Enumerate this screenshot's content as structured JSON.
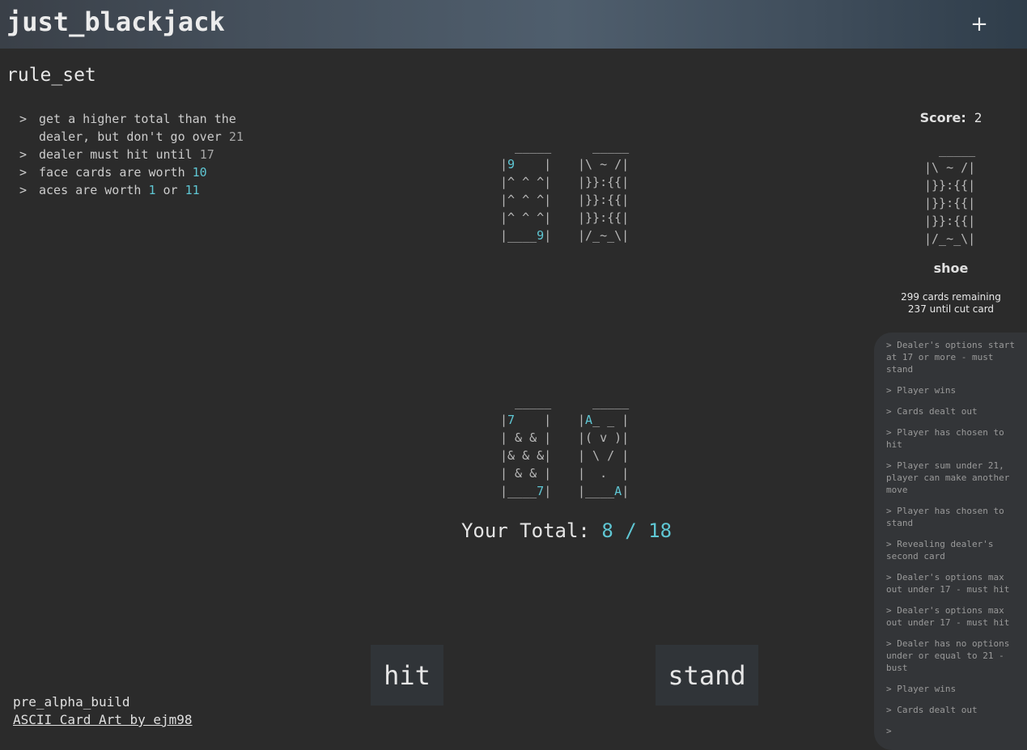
{
  "header": {
    "title": "just_blackjack",
    "add_label": "+"
  },
  "rules": {
    "title": "rule_set",
    "arrow": ">",
    "items": [
      {
        "text": "get a higher total than the dealer, but don't go over ",
        "num": "21"
      },
      {
        "text": "dealer must hit until ",
        "num": "17"
      },
      {
        "text": "face cards are worth ",
        "num": "10"
      },
      {
        "text": "aces are worth ",
        "num": "1",
        "mid": " or ",
        "num2": "11"
      }
    ]
  },
  "dealer": {
    "cards": [
      {
        "rank": "9",
        "face_up": true
      },
      {
        "rank": "",
        "face_up": false
      }
    ]
  },
  "player": {
    "cards": [
      {
        "rank": "7",
        "face_up": true
      },
      {
        "rank": "A",
        "face_up": true
      }
    ],
    "total_label": "Your Total:",
    "total_value": "8 / 18"
  },
  "score": {
    "label": "Score:",
    "value": "2"
  },
  "shoe": {
    "label": "shoe",
    "remaining": "299 cards remaining",
    "cut": "237 until cut card"
  },
  "log": [
    "> Dealer's options start at 17 or more - must stand",
    "> Player wins",
    "> Cards dealt out",
    "> Player has chosen to hit",
    "> Player sum under 21, player can make another move",
    "> Player has chosen to stand",
    "> Revealing dealer's second card",
    "> Dealer's options max out under 17 - must hit",
    "> Dealer's options max out under 17 - must hit",
    "> Dealer has no options under or equal to 21 - bust",
    "> Player wins",
    "> Cards dealt out",
    ">"
  ],
  "actions": {
    "hit": "hit",
    "stand": "stand"
  },
  "footer": {
    "build": "pre_alpha_build",
    "credit": "ASCII Card Art by ejm98"
  },
  "colors": {
    "background": "#2b2b2b",
    "accent": "#5fc7d4",
    "button_bg": "#303438",
    "log_bg": "#333538"
  }
}
